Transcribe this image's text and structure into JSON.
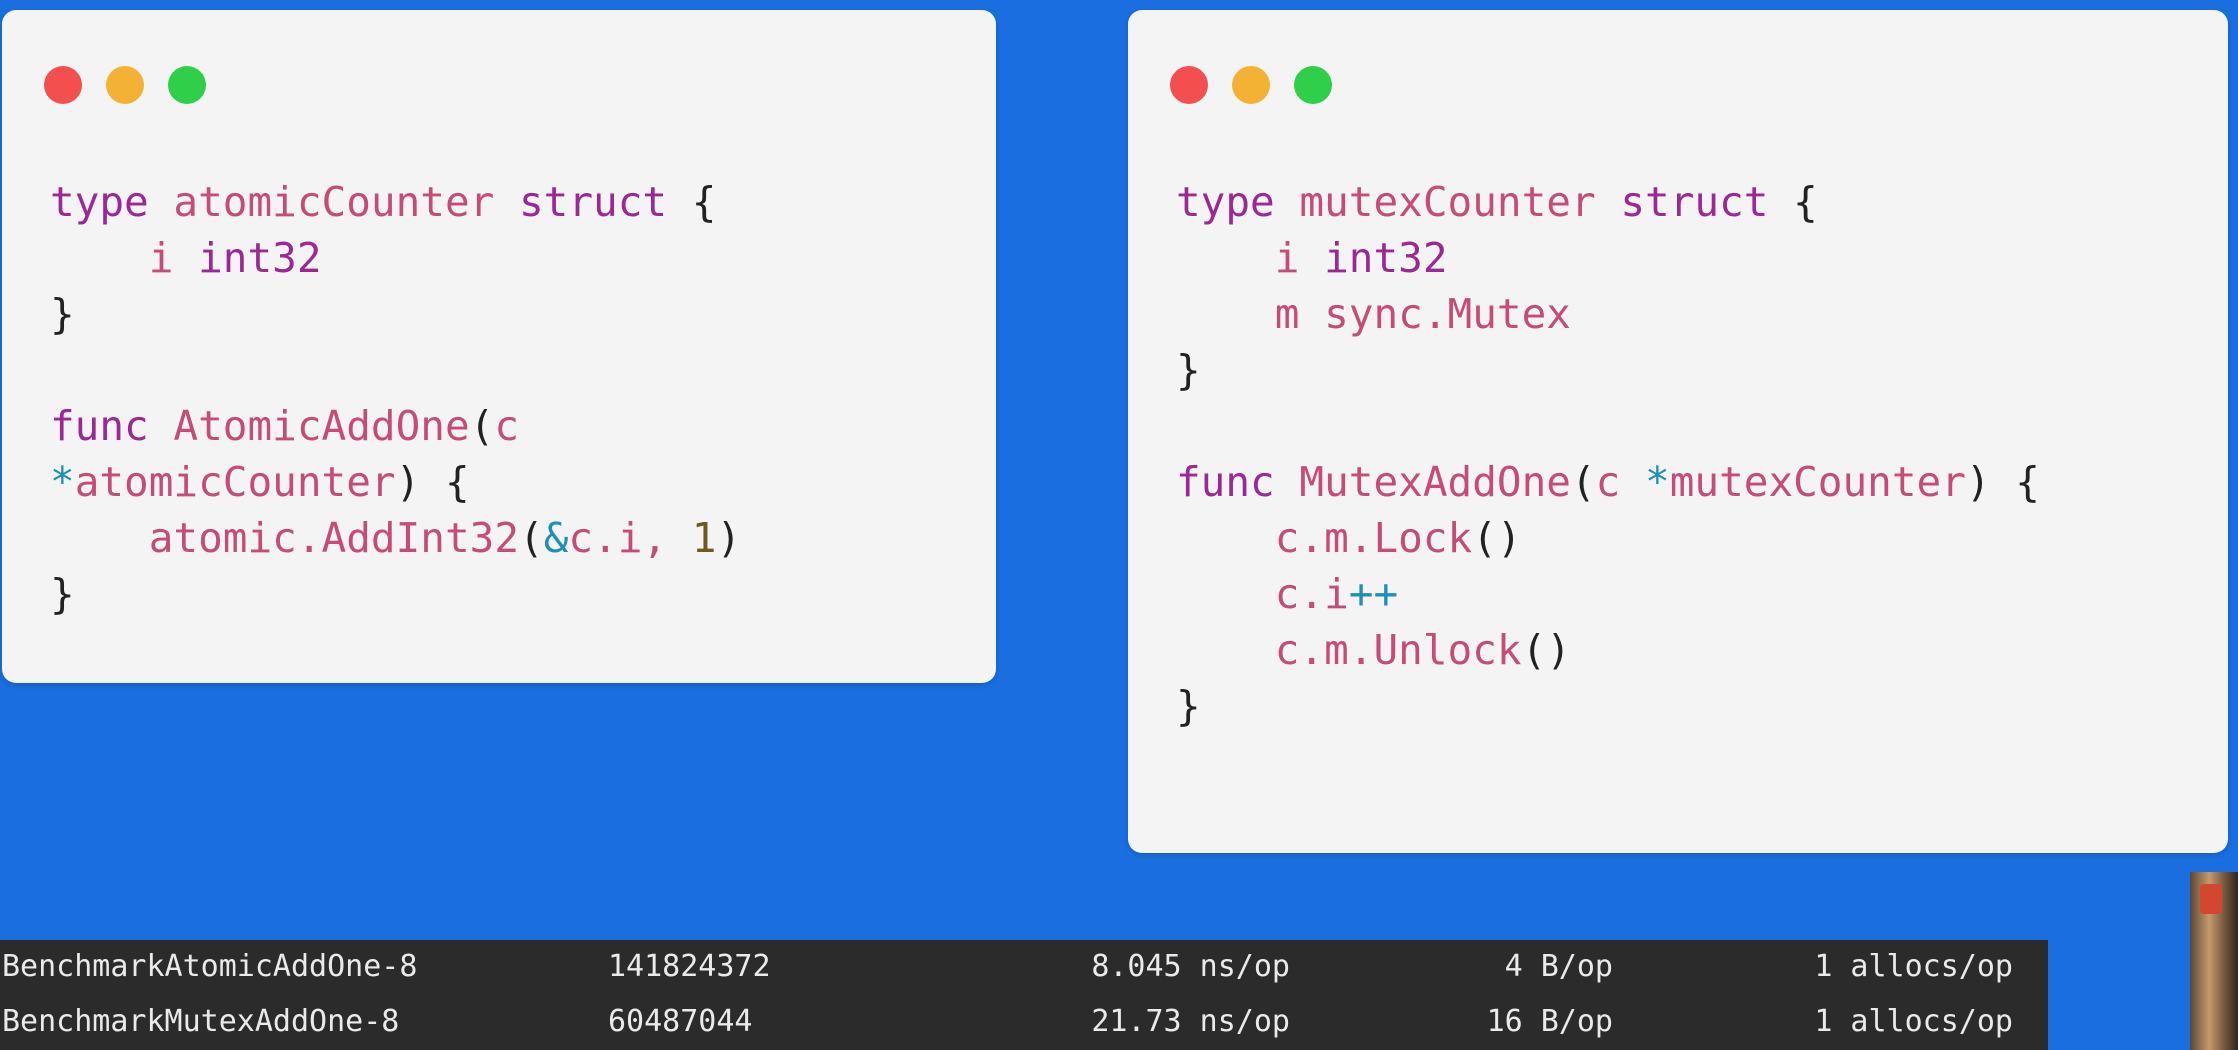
{
  "left_card": {
    "lines": [
      [
        {
          "t": "type ",
          "c": "kw"
        },
        {
          "t": "atomicCounter ",
          "c": "id"
        },
        {
          "t": "struct ",
          "c": "kw"
        },
        {
          "t": "{",
          "c": "pn"
        }
      ],
      [
        {
          "t": "    i ",
          "c": "id"
        },
        {
          "t": "int32",
          "c": "kw"
        }
      ],
      [
        {
          "t": "}",
          "c": "pn"
        }
      ],
      [],
      [
        {
          "t": "func ",
          "c": "kw"
        },
        {
          "t": "AtomicAddOne",
          "c": "id"
        },
        {
          "t": "(",
          "c": "pn"
        },
        {
          "t": "c",
          "c": "id"
        }
      ],
      [
        {
          "t": "*",
          "c": "op"
        },
        {
          "t": "atomicCounter",
          "c": "id"
        },
        {
          "t": ") {",
          "c": "pn"
        }
      ],
      [
        {
          "t": "    atomic.AddInt32",
          "c": "id"
        },
        {
          "t": "(",
          "c": "pn"
        },
        {
          "t": "&",
          "c": "op"
        },
        {
          "t": "c.i, ",
          "c": "id"
        },
        {
          "t": "1",
          "c": "num"
        },
        {
          "t": ")",
          "c": "pn"
        }
      ],
      [
        {
          "t": "}",
          "c": "pn"
        }
      ]
    ]
  },
  "right_card": {
    "lines": [
      [
        {
          "t": "type ",
          "c": "kw"
        },
        {
          "t": "mutexCounter ",
          "c": "id"
        },
        {
          "t": "struct ",
          "c": "kw"
        },
        {
          "t": "{",
          "c": "pn"
        }
      ],
      [
        {
          "t": "    i ",
          "c": "id"
        },
        {
          "t": "int32",
          "c": "kw"
        }
      ],
      [
        {
          "t": "    m sync.Mutex",
          "c": "id"
        }
      ],
      [
        {
          "t": "}",
          "c": "pn"
        }
      ],
      [],
      [
        {
          "t": "func ",
          "c": "kw"
        },
        {
          "t": "MutexAddOne",
          "c": "id"
        },
        {
          "t": "(",
          "c": "pn"
        },
        {
          "t": "c ",
          "c": "id"
        },
        {
          "t": "*",
          "c": "op"
        },
        {
          "t": "mutexCounter",
          "c": "id"
        },
        {
          "t": ") {",
          "c": "pn"
        }
      ],
      [
        {
          "t": "    c.m.Lock",
          "c": "id"
        },
        {
          "t": "()",
          "c": "pn"
        }
      ],
      [
        {
          "t": "    c.i",
          "c": "id"
        },
        {
          "t": "++",
          "c": "op"
        }
      ],
      [
        {
          "t": "    c.m.Unlock",
          "c": "id"
        },
        {
          "t": "()",
          "c": "pn"
        }
      ],
      [
        {
          "t": "}",
          "c": "pn"
        }
      ]
    ]
  },
  "benchmarks": [
    {
      "name": "BenchmarkAtomicAddOne-8",
      "iterations": "141824372",
      "ns": "8.045 ns/op",
      "bytes": "4 B/op",
      "allocs": "1 allocs/op"
    },
    {
      "name": "BenchmarkMutexAddOne-8",
      "iterations": "60487044",
      "ns": "21.73 ns/op",
      "bytes": "16 B/op",
      "allocs": "1 allocs/op"
    }
  ],
  "colors": {
    "background": "#1a6ee0",
    "keyword": "#9b2896",
    "identifier": "#c64b79",
    "operator": "#1e8fb6",
    "dot_red": "#f44f4f",
    "dot_yellow": "#f4b234",
    "dot_green": "#2fcf4a"
  }
}
